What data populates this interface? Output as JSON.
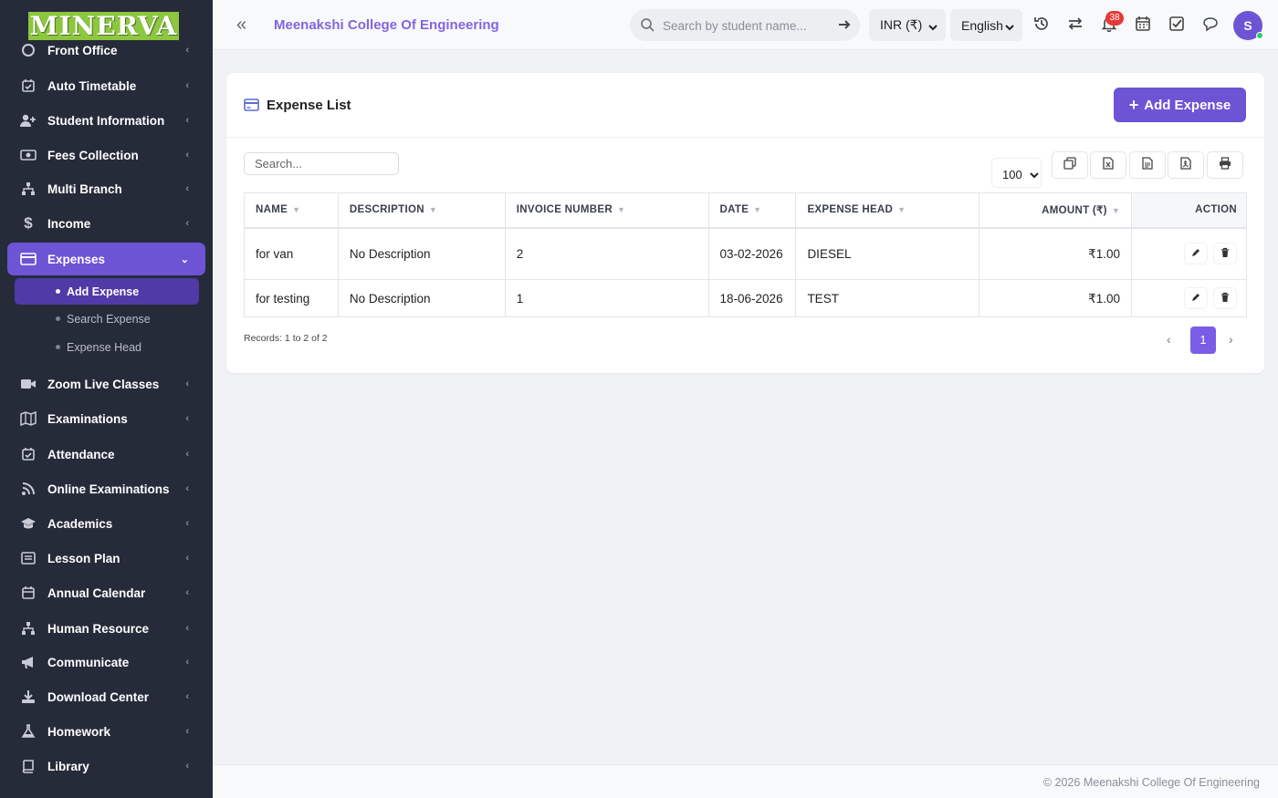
{
  "brand": {
    "logo_text": "MINERVA"
  },
  "sidebar": {
    "items": [
      {
        "label": "Front Office",
        "icon": "front-office-icon"
      },
      {
        "label": "Auto Timetable",
        "icon": "calendar-check-icon"
      },
      {
        "label": "Student Information",
        "icon": "user-plus-icon"
      },
      {
        "label": "Fees Collection",
        "icon": "money-icon"
      },
      {
        "label": "Multi Branch",
        "icon": "sitemap-icon"
      },
      {
        "label": "Income",
        "icon": "dollar-icon"
      },
      {
        "label": "Expenses",
        "icon": "credit-card-icon",
        "expanded": true
      },
      {
        "label": "Zoom Live Classes",
        "icon": "video-icon"
      },
      {
        "label": "Examinations",
        "icon": "map-icon"
      },
      {
        "label": "Attendance",
        "icon": "calendar-check-icon"
      },
      {
        "label": "Online Examinations",
        "icon": "rss-icon"
      },
      {
        "label": "Academics",
        "icon": "graduation-cap-icon"
      },
      {
        "label": "Lesson Plan",
        "icon": "list-alt-icon"
      },
      {
        "label": "Annual Calendar",
        "icon": "calendar-icon"
      },
      {
        "label": "Human Resource",
        "icon": "sitemap-icon"
      },
      {
        "label": "Communicate",
        "icon": "bullhorn-icon"
      },
      {
        "label": "Download Center",
        "icon": "download-icon"
      },
      {
        "label": "Homework",
        "icon": "flask-icon"
      },
      {
        "label": "Library",
        "icon": "book-icon"
      }
    ],
    "sub_items": [
      {
        "label": "Add Expense",
        "active": true
      },
      {
        "label": "Search Expense",
        "active": false
      },
      {
        "label": "Expense Head",
        "active": false
      }
    ]
  },
  "header": {
    "college_name": "Meenakshi College Of Engineering",
    "search_placeholder": "Search by student name...",
    "currency": "INR (₹)",
    "language": "English",
    "notification_count": "38",
    "avatar_initial": "S"
  },
  "main": {
    "title": "Expense List",
    "add_button": "Add Expense",
    "search_placeholder": "Search...",
    "per_page": "100",
    "columns": [
      "NAME",
      "DESCRIPTION",
      "INVOICE NUMBER",
      "DATE",
      "EXPENSE HEAD",
      "AMOUNT (₹)",
      "ACTION"
    ],
    "rows": [
      {
        "name": "for van",
        "description": "No Description",
        "invoice": "2",
        "date": "03-02-2026",
        "head": "DIESEL",
        "amount": "₹1.00"
      },
      {
        "name": "for testing",
        "description": "No Description",
        "invoice": "1",
        "date": "18-06-2026",
        "head": "TEST",
        "amount": "₹1.00"
      }
    ],
    "records_text": "Records: 1 to 2 of 2",
    "current_page": "1"
  },
  "footer": {
    "text": "© 2026 Meenakshi College Of Engineering"
  },
  "colors": {
    "accent": "#6c54d4",
    "sidebar_bg": "#262b3a",
    "title": "#8563e0",
    "logo_bg": "#8dc63f"
  }
}
